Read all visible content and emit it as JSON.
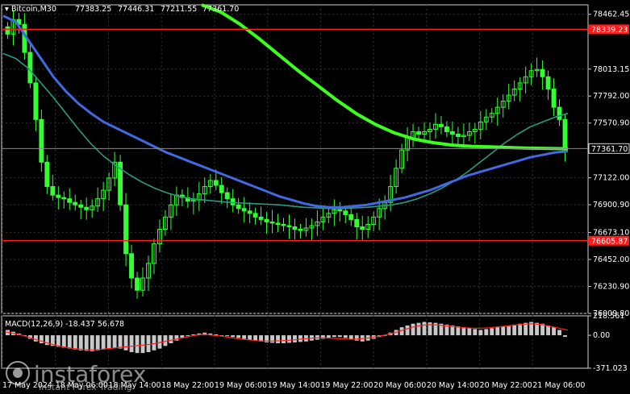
{
  "window": {
    "symbol": "Bitcoin,M30",
    "ohlc": [
      "77383.25",
      "77446.31",
      "77211.55",
      "77361.70"
    ]
  },
  "brand": {
    "name": "instaforex",
    "tagline": "Instant Forex Trading"
  },
  "colors": {
    "background": "#000000",
    "candles": "#32ff32",
    "ma_fast": "#2a9a82",
    "ma_mid": "#4169e1",
    "ma_slow": "#3cff1e",
    "level_lines": "#ff1a1a",
    "macd_hist": "#c8c8c8",
    "macd_signal": "#ff2020"
  },
  "chart_data": [
    {
      "type": "line",
      "title": "",
      "ylim": [
        76009.8,
        78540
      ],
      "ytick_labels": [
        "78462.45",
        "78013.15",
        "77792.00",
        "77570.90",
        "77122.00",
        "76900.90",
        "76673.10",
        "76452.00",
        "76230.90",
        "76009.80"
      ],
      "ytick_values": [
        78462.45,
        78013.15,
        77792.0,
        77570.9,
        77122.0,
        76900.9,
        76673.1,
        76452.0,
        76230.9,
        76009.8
      ],
      "xtick_labels": [
        "17 May 2024",
        "18 May 06:00",
        "18 May 14:00",
        "18 May 22:00",
        "19 May 06:00",
        "19 May 14:00",
        "19 May 22:00",
        "20 May 06:00",
        "20 May 14:00",
        "20 May 22:00",
        "21 May 06:00"
      ],
      "horizontal_levels": [
        {
          "label": "78339.23",
          "value": 78339.23
        },
        {
          "label": "76605.87",
          "value": 76605.87
        }
      ],
      "current_price": {
        "label": "77361.70",
        "value": 77361.7
      },
      "candles_close": [
        78300,
        78420,
        78380,
        78150,
        77900,
        77600,
        77250,
        77050,
        76980,
        76960,
        76950,
        76920,
        76900,
        76880,
        76860,
        76890,
        76950,
        77020,
        77120,
        77250,
        76900,
        76500,
        76300,
        76200,
        76300,
        76420,
        76580,
        76700,
        76800,
        76900,
        76980,
        76960,
        76930,
        76940,
        76990,
        77050,
        77100,
        77060,
        77000,
        76950,
        76900,
        76870,
        76850,
        76830,
        76800,
        76780,
        76760,
        76750,
        76740,
        76730,
        76720,
        76700,
        76690,
        76710,
        76730,
        76760,
        76800,
        76830,
        76860,
        76850,
        76820,
        76780,
        76720,
        76700,
        76740,
        76800,
        76870,
        76920,
        77050,
        77200,
        77350,
        77450,
        77500,
        77480,
        77500,
        77520,
        77560,
        77540,
        77500,
        77480,
        77460,
        77470,
        77500,
        77520,
        77580,
        77620,
        77650,
        77700,
        77750,
        77800,
        77850,
        77900,
        77950,
        78000,
        78010,
        77950,
        77850,
        77700,
        77600,
        77361.7
      ],
      "series": [
        {
          "values": [
            78140,
            78100,
            78020,
            77900,
            77780,
            77650,
            77520,
            77400,
            77300,
            77220,
            77150,
            77090,
            77040,
            77000,
            76970,
            76950,
            76940,
            76930,
            76920,
            76915,
            76910,
            76905,
            76900,
            76890,
            76880,
            76875,
            76870,
            76870,
            76875,
            76880,
            76890,
            76900,
            76920,
            76950,
            76990,
            77040,
            77100,
            77170,
            77250,
            77330,
            77410,
            77480,
            77540,
            77580,
            77620,
            77650
          ]
        },
        {
          "values": [
            78450,
            78400,
            78250,
            78100,
            77950,
            77830,
            77730,
            77650,
            77580,
            77530,
            77480,
            77430,
            77380,
            77330,
            77290,
            77250,
            77210,
            77170,
            77130,
            77090,
            77050,
            77010,
            76970,
            76940,
            76910,
            76890,
            76880,
            76880,
            76890,
            76900,
            76920,
            76940,
            76960,
            76990,
            77020,
            77060,
            77100,
            77140,
            77170,
            77200,
            77230,
            77260,
            77290,
            77310,
            77330,
            77340
          ]
        },
        {
          "values": [
            78540,
            78480,
            78380,
            78260,
            78130,
            78000,
            77880,
            77760,
            77650,
            77560,
            77490,
            77440,
            77410,
            77390,
            77380,
            77375,
            77370,
            77365,
            77362,
            77360
          ]
        }
      ]
    },
    {
      "type": "bar",
      "title": "MACD(12,26,9) -18.437 56.678",
      "ylim": [
        -371.023,
        218.561
      ],
      "ytick_labels": [
        "218.561",
        "0.00",
        "-371.023"
      ],
      "ytick_values": [
        218.561,
        0,
        -371.023
      ],
      "values": [
        60,
        40,
        20,
        -10,
        -40,
        -70,
        -90,
        -110,
        -120,
        -130,
        -140,
        -150,
        -160,
        -170,
        -175,
        -180,
        -170,
        -160,
        -150,
        -140,
        -150,
        -170,
        -190,
        -200,
        -200,
        -190,
        -170,
        -150,
        -120,
        -90,
        -60,
        -30,
        -10,
        10,
        20,
        30,
        20,
        10,
        0,
        -10,
        -20,
        -30,
        -40,
        -50,
        -60,
        -70,
        -80,
        -85,
        -90,
        -90,
        -85,
        -80,
        -75,
        -70,
        -60,
        -50,
        -40,
        -30,
        -20,
        -20,
        -30,
        -40,
        -60,
        -70,
        -60,
        -40,
        -20,
        0,
        30,
        60,
        90,
        110,
        130,
        140,
        150,
        145,
        140,
        130,
        120,
        110,
        100,
        90,
        80,
        70,
        60,
        70,
        80,
        90,
        100,
        110,
        120,
        130,
        140,
        150,
        140,
        130,
        110,
        90,
        60,
        -18.437
      ],
      "series": [
        {
          "values": [
            40,
            20,
            0,
            -30,
            -60,
            -90,
            -115,
            -135,
            -150,
            -160,
            -165,
            -160,
            -150,
            -140,
            -130,
            -120,
            -110,
            -100,
            -80,
            -60,
            -40,
            -20,
            0,
            10,
            0,
            -10,
            -25,
            -40,
            -50,
            -60,
            -65,
            -65,
            -60,
            -55,
            -45,
            -35,
            -30,
            -30,
            -35,
            -40,
            -45,
            -40,
            -30,
            -15,
            5,
            30,
            60,
            90,
            110,
            120,
            115,
            105,
            95,
            85,
            80,
            80,
            85,
            95,
            105,
            115,
            125,
            130,
            120,
            100,
            80,
            56.678
          ]
        }
      ]
    }
  ]
}
